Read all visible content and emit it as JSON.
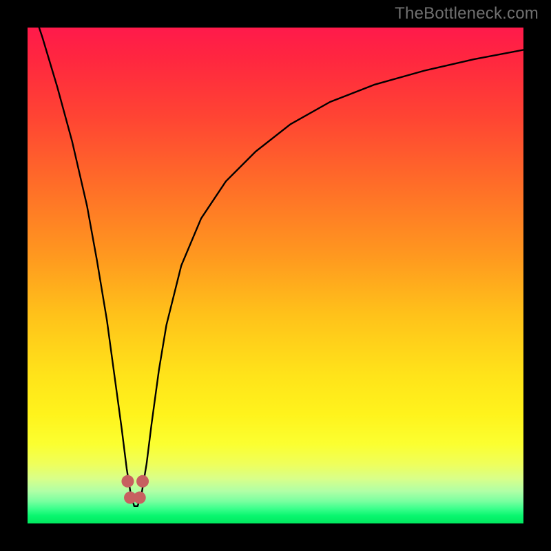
{
  "watermark": "TheBottleneck.com",
  "chart_data": {
    "type": "line",
    "title": "",
    "xlabel": "",
    "ylabel": "",
    "xlim": [
      0,
      100
    ],
    "ylim": [
      0,
      100
    ],
    "grid": false,
    "legend": false,
    "background_gradient": {
      "top_color": "#FF1A4B",
      "bottom_color": "#02E860",
      "meaning": "top=red=worst, bottom=green=best"
    },
    "series": [
      {
        "name": "bottleneck-curve",
        "x": [
          0,
          3,
          6,
          9,
          12,
          14,
          16,
          17.5,
          19,
          20,
          20.8,
          21.5,
          22.2,
          23,
          24,
          25,
          26.5,
          28,
          31,
          35,
          40,
          46,
          53,
          61,
          70,
          80,
          90,
          100
        ],
        "y": [
          107,
          98,
          88,
          77,
          64,
          53,
          41,
          30,
          19,
          11,
          6,
          3.5,
          3.5,
          6,
          12,
          20,
          31,
          40,
          52,
          61.5,
          69,
          75,
          80.5,
          85,
          88.5,
          91.3,
          93.6,
          95.5
        ]
      }
    ],
    "markers": [
      {
        "name": "dot-left-upper",
        "x": 20.2,
        "y": 8.5
      },
      {
        "name": "dot-left-lower",
        "x": 20.7,
        "y": 5.2
      },
      {
        "name": "dot-right-lower",
        "x": 22.6,
        "y": 5.2
      },
      {
        "name": "dot-right-upper",
        "x": 23.2,
        "y": 8.5
      }
    ],
    "marker_style": {
      "color": "#C76060",
      "radius_px": 9
    }
  }
}
